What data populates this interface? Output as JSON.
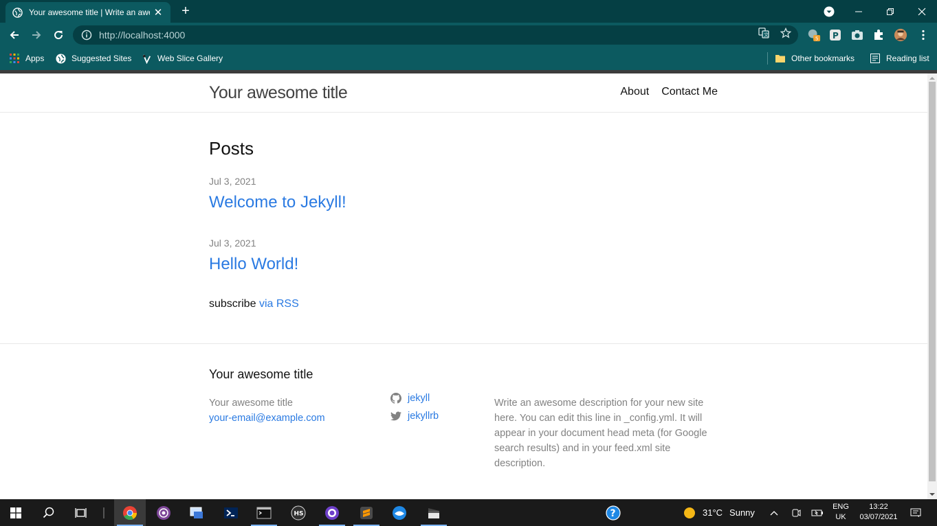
{
  "browser": {
    "tab": {
      "title": "Your awesome title | Write an awesome description",
      "close_glyph": "✕"
    },
    "new_tab_glyph": "+",
    "address": {
      "prefix": "http://",
      "host": "localhost",
      "port": ":4000",
      "full": "http://localhost:4000"
    },
    "bookmarks": [
      {
        "label": "Apps",
        "icon": "apps-grid-icon"
      },
      {
        "label": "Suggested Sites",
        "icon": "globe-icon"
      },
      {
        "label": "Web Slice Gallery",
        "icon": "web-slice-icon"
      }
    ],
    "other_bookmarks": "Other bookmarks",
    "reading_list": "Reading list",
    "extension_badge": "5",
    "accent": "#0c5a60",
    "chrome_dark": "#053f44"
  },
  "site": {
    "title": "Your awesome title",
    "nav": [
      "About",
      "Contact Me"
    ],
    "posts_heading": "Posts",
    "posts": [
      {
        "date": "Jul 3, 2021",
        "title": "Welcome to Jekyll!"
      },
      {
        "date": "Jul 3, 2021",
        "title": "Hello World!"
      }
    ],
    "subscribe_text": "subscribe",
    "subscribe_link": "via RSS",
    "link_color": "#2a7ae2"
  },
  "footer": {
    "heading": "Your awesome title",
    "name": "Your awesome title",
    "email": "your-email@example.com",
    "github": "jekyll",
    "twitter": "jekyllrb",
    "description": "Write an awesome description for your new site here. You can edit this line in _config.yml. It will appear in your document head meta (for Google search results) and in your feed.xml site description."
  },
  "taskbar": {
    "weather": {
      "temp": "31°C",
      "condition": "Sunny"
    },
    "lang_top": "ENG",
    "lang_bottom": "UK",
    "time": "13:22",
    "date": "03/07/2021"
  }
}
